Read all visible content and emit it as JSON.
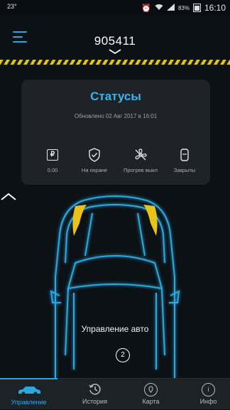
{
  "status_bar": {
    "left_text": "23°",
    "battery": "83%",
    "time": "16:10",
    "icons": [
      "alarm-clock-icon",
      "wifi-icon",
      "signal-icon",
      "battery-icon"
    ]
  },
  "header": {
    "title": "905411",
    "menu_icon": "hamburger-menu-icon",
    "dropdown_icon": "chevron-down-icon",
    "accent": "#2aa8e0"
  },
  "status_card": {
    "title": "Статусы",
    "updated": "Обновлено 02 Авг 2017 в 16:01",
    "items": [
      {
        "icon": "ruble-icon",
        "label": "0.00"
      },
      {
        "icon": "shield-check-icon",
        "label": "На охране"
      },
      {
        "icon": "fan-off-icon",
        "label": "Прогрев выкл"
      },
      {
        "icon": "lock-icon",
        "label": "Закрыты"
      }
    ]
  },
  "car_panel": {
    "label": "Управление авто",
    "badge": "2",
    "expand_icon": "chevron-up-icon"
  },
  "bottom_nav": {
    "items": [
      {
        "label": "Управление",
        "icon": "car-icon",
        "active": true
      },
      {
        "label": "История",
        "icon": "history-icon",
        "active": false
      },
      {
        "label": "Карта",
        "icon": "map-pin-icon",
        "active": false
      },
      {
        "label": "Инфо",
        "icon": "info-icon",
        "active": false
      }
    ]
  },
  "colors": {
    "background": "#0c1116",
    "card": "#1f2327",
    "accent_blue": "#2aa8e0",
    "headlight_yellow": "#e8c31a",
    "stripe_yellow": "#e2c21f"
  }
}
